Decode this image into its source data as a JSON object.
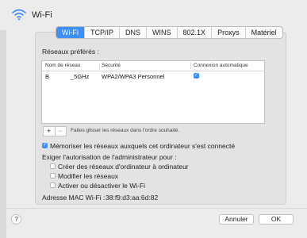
{
  "window": {
    "title": "Wi-Fi"
  },
  "tabs": [
    {
      "label": "Wi-Fi",
      "active": true
    },
    {
      "label": "TCP/IP",
      "active": false
    },
    {
      "label": "DNS",
      "active": false
    },
    {
      "label": "WINS",
      "active": false
    },
    {
      "label": "802.1X",
      "active": false
    },
    {
      "label": "Proxys",
      "active": false
    },
    {
      "label": "Matériel",
      "active": false
    }
  ],
  "preferred_networks": {
    "label": "Réseaux préférés :",
    "columns": [
      "Nom de réseau",
      "Sécurité",
      "Connexion automatique"
    ],
    "rows": [
      {
        "name_prefix": "B",
        "name": "_5GHz",
        "security": "WPA2/WPA3 Personnel",
        "auto_join": true
      }
    ],
    "add_label": "+",
    "remove_label": "−",
    "drag_hint": "Faites glisser les réseaux dans l'ordre souhaité."
  },
  "options": {
    "remember_label": "Mémoriser les réseaux auxquels cet ordinateur s'est connecté",
    "remember_checked": true,
    "admin_required_label": "Exiger l'autorisation de l'administrateur pour :",
    "admin_items": [
      {
        "label": "Créer des réseaux d'ordinateur à ordinateur",
        "checked": false
      },
      {
        "label": "Modifier les réseaux",
        "checked": false
      },
      {
        "label": "Activer ou désactiver le Wi-Fi",
        "checked": false
      }
    ]
  },
  "mac": {
    "label": "Adresse MAC Wi-Fi :",
    "value": "38:f9:d3:aa:6d:82"
  },
  "footer": {
    "help_label": "?",
    "cancel_label": "Annuler",
    "ok_label": "OK"
  },
  "colors": {
    "accent": "#3d8ef7",
    "background": "#ececec"
  }
}
